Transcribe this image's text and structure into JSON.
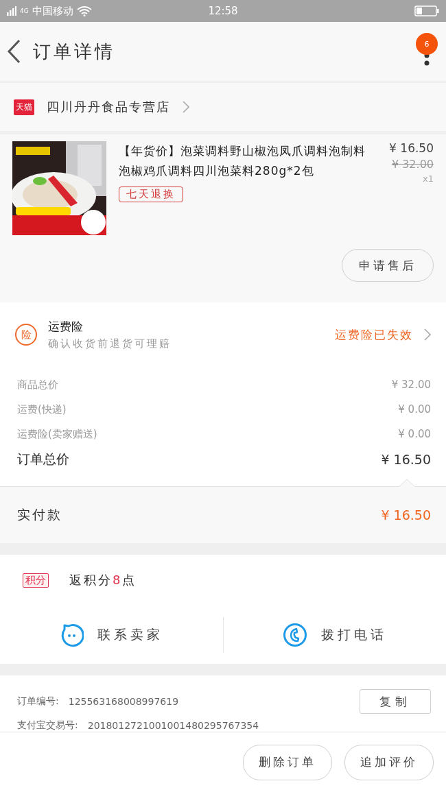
{
  "status_bar": {
    "network": "4G",
    "carrier": "中国移动",
    "time": "12:58"
  },
  "header": {
    "title": "订单详情",
    "badge": "6"
  },
  "shop": {
    "badge": "天猫",
    "name": "四川丹丹食品专营店"
  },
  "product": {
    "title": "【年货价】泡菜调料野山椒泡凤爪调料泡制料泡椒鸡爪调料四川泡菜料280g*2包",
    "tag": "七天退换",
    "price": "¥ 16.50",
    "original_price": "¥ 32.00",
    "quantity": "x1",
    "action": "申请售后"
  },
  "insurance": {
    "icon": "险",
    "title": "运费险",
    "subtitle": "确认收货前退货可理赔",
    "status": "运费险已失效"
  },
  "costs": [
    {
      "label": "商品总价",
      "value": "¥ 32.00",
      "kind": "line"
    },
    {
      "label": "运费(快递)",
      "value": "¥ 0.00",
      "kind": "line"
    },
    {
      "label": "运费险(卖家赠送)",
      "value": "¥ 0.00",
      "kind": "line"
    },
    {
      "label": "订单总价",
      "value": "¥ 16.50",
      "kind": "total"
    }
  ],
  "payment": {
    "label": "实付款",
    "value": "¥ 16.50"
  },
  "points": {
    "badge": "积分",
    "prefix": "返积分",
    "amount": "8",
    "suffix": "点"
  },
  "contact": [
    {
      "label": "联系卖家",
      "kind": "chat"
    },
    {
      "label": "拨打电话",
      "kind": "phone"
    }
  ],
  "order_info": [
    {
      "label": "订单编号:",
      "value": "125563168008997619",
      "action": "复制"
    },
    {
      "label": "支付宝交易号:",
      "value": "2018012721001001480295767354"
    }
  ],
  "footer_buttons": [
    "删除订单",
    "追加评价"
  ]
}
